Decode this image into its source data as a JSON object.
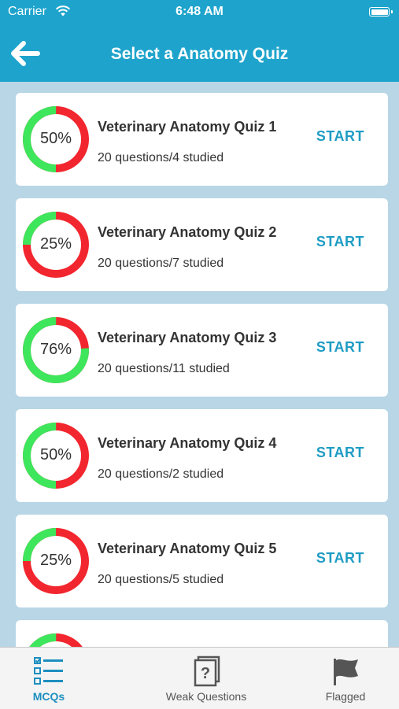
{
  "status_bar": {
    "carrier": "Carrier",
    "time": "6:48 AM"
  },
  "nav": {
    "title": "Select a Anatomy Quiz"
  },
  "quizzes": [
    {
      "title": "Veterinary Anatomy Quiz 1",
      "subtitle": "20 questions/4 studied",
      "percent_label": "50%",
      "percent": 50,
      "start_label": "START"
    },
    {
      "title": "Veterinary Anatomy Quiz 2",
      "subtitle": "20 questions/7 studied",
      "percent_label": "25%",
      "percent": 25,
      "start_label": "START"
    },
    {
      "title": "Veterinary Anatomy Quiz 3",
      "subtitle": "20 questions/11 studied",
      "percent_label": "76%",
      "percent": 76,
      "start_label": "START"
    },
    {
      "title": "Veterinary Anatomy Quiz 4",
      "subtitle": "20 questions/2 studied",
      "percent_label": "50%",
      "percent": 50,
      "start_label": "START"
    },
    {
      "title": "Veterinary Anatomy Quiz 5",
      "subtitle": "20 questions/5 studied",
      "percent_label": "25%",
      "percent": 25,
      "start_label": "START"
    },
    {
      "percent": 76
    }
  ],
  "tabs": [
    {
      "label": "MCQs",
      "icon": "list-check-icon",
      "active": true
    },
    {
      "label": "Weak Questions",
      "icon": "question-doc-icon",
      "active": false
    },
    {
      "label": "Flagged",
      "icon": "flag-icon",
      "active": false
    }
  ],
  "colors": {
    "header": "#1ea4cc",
    "background": "#b8d6e6",
    "ring_correct": "#3ee65c",
    "ring_remaining": "#f2262e",
    "accent": "#1e9cc4"
  }
}
